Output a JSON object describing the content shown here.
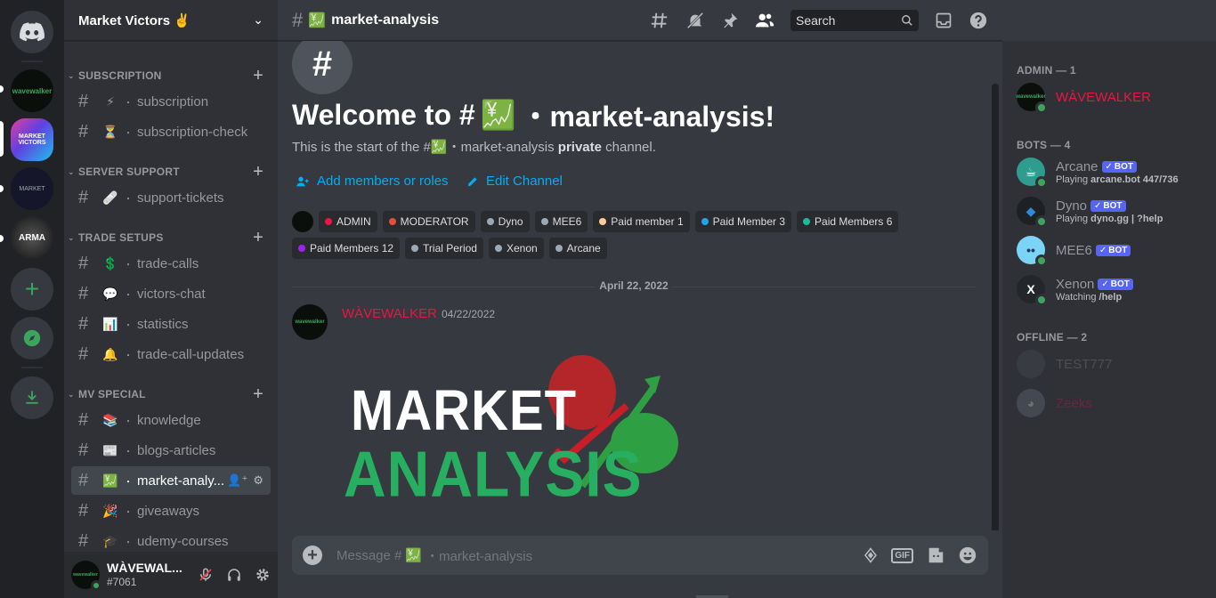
{
  "guild": {
    "name": "Market Victors ✌️"
  },
  "servers": [
    {
      "name": "wavewalker-server",
      "label": "wavewalker"
    },
    {
      "name": "market-victors-server",
      "label": "MARKET VICTORS"
    },
    {
      "name": "third-server",
      "label": "MARKET"
    },
    {
      "name": "arma-server",
      "label": "ARMA"
    }
  ],
  "categories": {
    "subscription": "SUBSCRIPTION",
    "server_support": "SERVER SUPPORT",
    "trade_setups": "TRADE SETUPS",
    "mv_special": "MV SPECIAL"
  },
  "channels": [
    {
      "emoji": "⚡",
      "name": "subscription"
    },
    {
      "emoji": "⏳",
      "name": "subscription-check"
    },
    {
      "emoji": "🩹",
      "name": "support-tickets"
    },
    {
      "emoji": "💲",
      "name": "trade-calls"
    },
    {
      "emoji": "💬",
      "name": "victors-chat"
    },
    {
      "emoji": "📊",
      "name": "statistics"
    },
    {
      "emoji": "🔔",
      "name": "trade-call-updates"
    },
    {
      "emoji": "📚",
      "name": "knowledge"
    },
    {
      "emoji": "📰",
      "name": "blogs-articles"
    },
    {
      "emoji": "💹",
      "name": "market-analy..."
    },
    {
      "emoji": "🎉",
      "name": "giveaways"
    },
    {
      "emoji": "🎓",
      "name": "udemy-courses"
    }
  ],
  "user": {
    "name": "WÀVEWAL...",
    "tag": "#7061",
    "avatar_text": "wavewalker"
  },
  "topbar": {
    "channel_emoji": "💹",
    "channel_name": "market-analysis",
    "search_placeholder": "Search"
  },
  "welcome": {
    "title_prefix": "Welcome to #",
    "emoji": "💹",
    "title_suffix": "・market-analysis!",
    "sub_prefix": "This is the start of the #",
    "sub_channel": "・market-analysis",
    "sub_private": "private",
    "sub_suffix": "channel.",
    "add_members": "Add members or roles",
    "edit_channel": "Edit Channel"
  },
  "roles": [
    {
      "name": "ADMIN",
      "color": "#ed1444"
    },
    {
      "name": "MODERATOR",
      "color": "#e74c3c"
    },
    {
      "name": "Dyno",
      "color": "#99aab5"
    },
    {
      "name": "MEE6",
      "color": "#99aab5"
    },
    {
      "name": "Paid member 1",
      "color": "#ffcc99"
    },
    {
      "name": "Paid Member 3",
      "color": "#1fa6e8"
    },
    {
      "name": "Paid Members 6",
      "color": "#1abc9c"
    },
    {
      "name": "Paid Members 12",
      "color": "#a020f0"
    },
    {
      "name": "Trial Period",
      "color": "#99aab5"
    },
    {
      "name": "Xenon",
      "color": "#99aab5"
    },
    {
      "name": "Arcane",
      "color": "#99aab5"
    }
  ],
  "date_divider": "April 22, 2022",
  "message": {
    "author": "WÀVEWALKER",
    "timestamp": "04/22/2022",
    "image_line1": "MARKET",
    "image_line2": "ANALYSIS"
  },
  "composer": {
    "placeholder_prefix": "Message #",
    "placeholder_channel": "・market-analysis",
    "gif": "GIF"
  },
  "members": {
    "admin_header": "ADMIN — 1",
    "bots_header": "BOTS — 4",
    "offline_header": "OFFLINE — 2",
    "admin": [
      {
        "name": "WÀVEWALKER",
        "color": "#ed1444"
      }
    ],
    "bots": [
      {
        "name": "Arcane",
        "activity_prefix": "Playing",
        "activity": "arcane.bot 447/736",
        "avatar_color": "#2f9c8f"
      },
      {
        "name": "Dyno",
        "activity_prefix": "Playing",
        "activity": "dyno.gg | ?help",
        "avatar_color": "#1e2124"
      },
      {
        "name": "MEE6",
        "activity_prefix": "",
        "activity": "",
        "avatar_color": "#7bd3f5"
      },
      {
        "name": "Xenon",
        "activity_prefix": "Watching",
        "activity": "/help",
        "avatar_color": "#23272a"
      }
    ],
    "bot_tag": "BOT",
    "offline": [
      {
        "name": "TEST777",
        "color": "#8e9297"
      },
      {
        "name": "Zeeks",
        "color": "#ed1444"
      }
    ]
  }
}
